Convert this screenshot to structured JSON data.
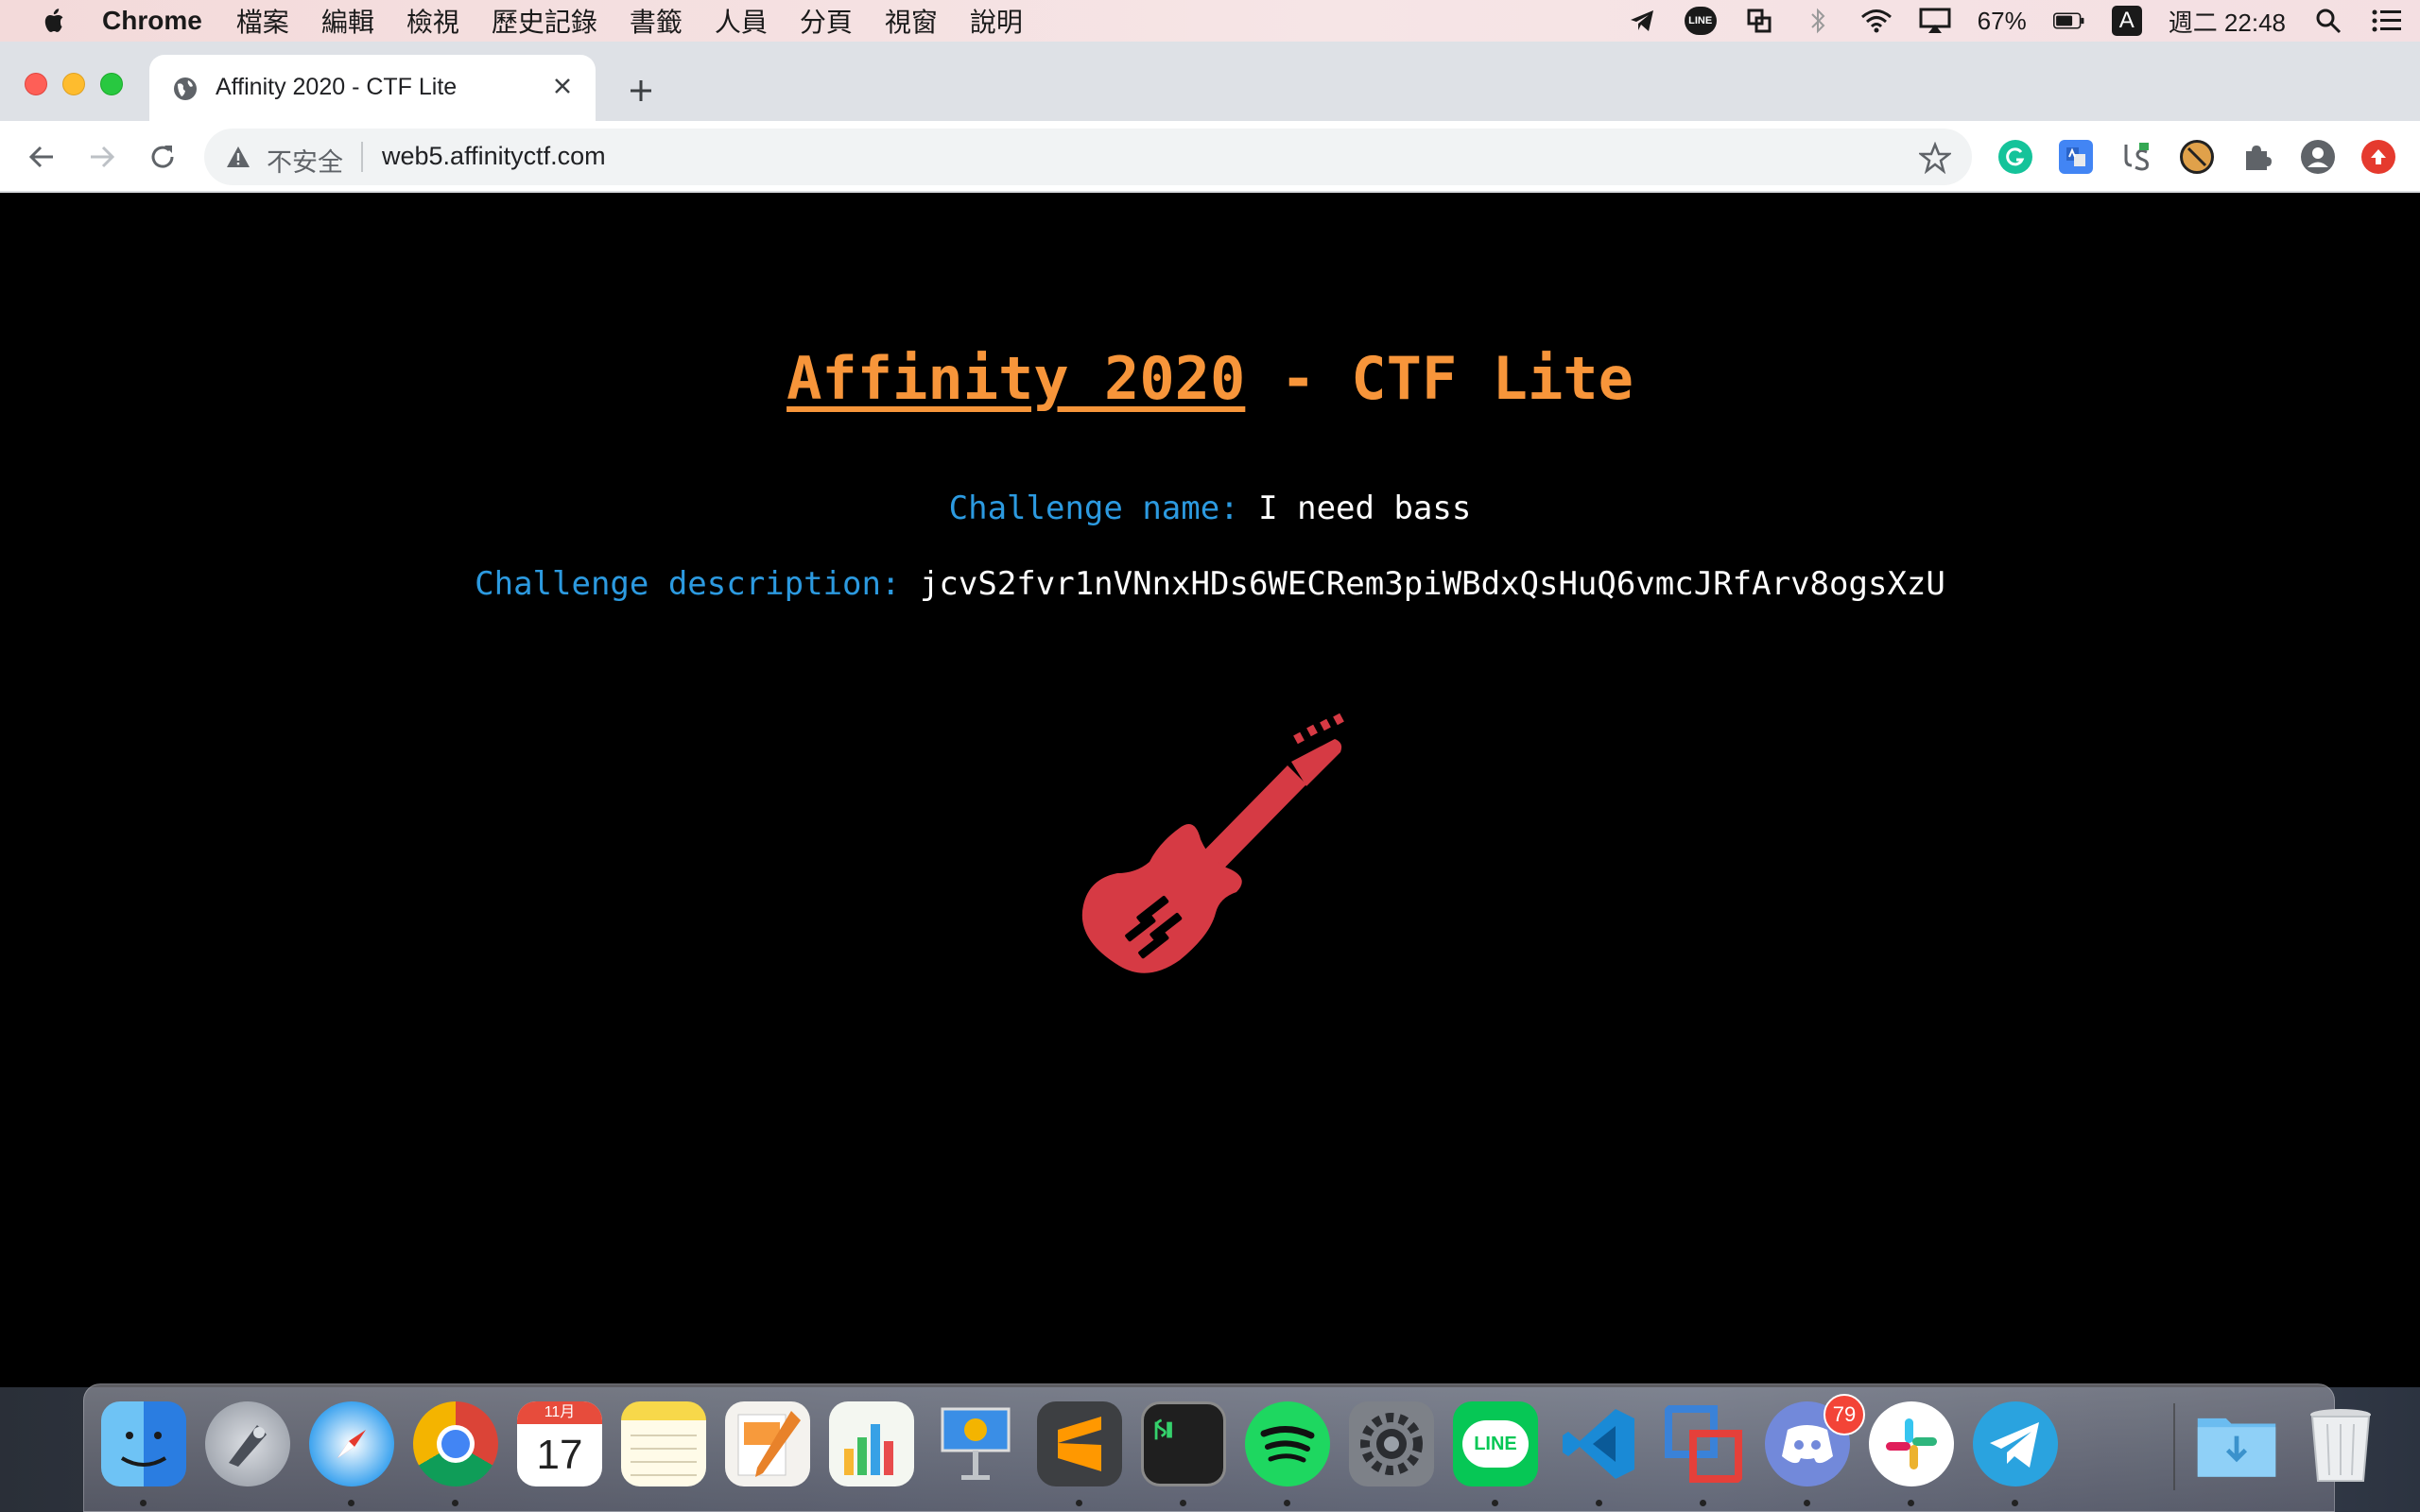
{
  "menubar": {
    "app_name": "Chrome",
    "menus": [
      "檔案",
      "編輯",
      "檢視",
      "歷史記錄",
      "書籤",
      "人員",
      "分頁",
      "視窗",
      "說明"
    ],
    "line_label": "LINE",
    "battery_percent": "67%",
    "input_method": "A",
    "clock": "週二 22:48"
  },
  "browser": {
    "tab_title": "Affinity 2020 - CTF Lite",
    "security_label": "不安全",
    "url": "web5.affinityctf.com"
  },
  "page": {
    "heading_link": "Affinity 2020",
    "heading_rest": " - CTF Lite",
    "name_label": "Challenge name:",
    "name_value": "I need bass",
    "desc_label": "Challenge description:",
    "desc_value": "jcvS2fvr1nVNnxHDs6WECRem3piWBdxQsHuQ6vmcJRfArv8ogsXzU",
    "guitar_color": "#d63a44"
  },
  "dock": {
    "calendar_month": "11月",
    "calendar_day": "17",
    "line_label": "LINE",
    "discord_badge": "79"
  },
  "colors": {
    "accent_orange": "#f7953a",
    "label_blue": "#2c9ae0"
  }
}
